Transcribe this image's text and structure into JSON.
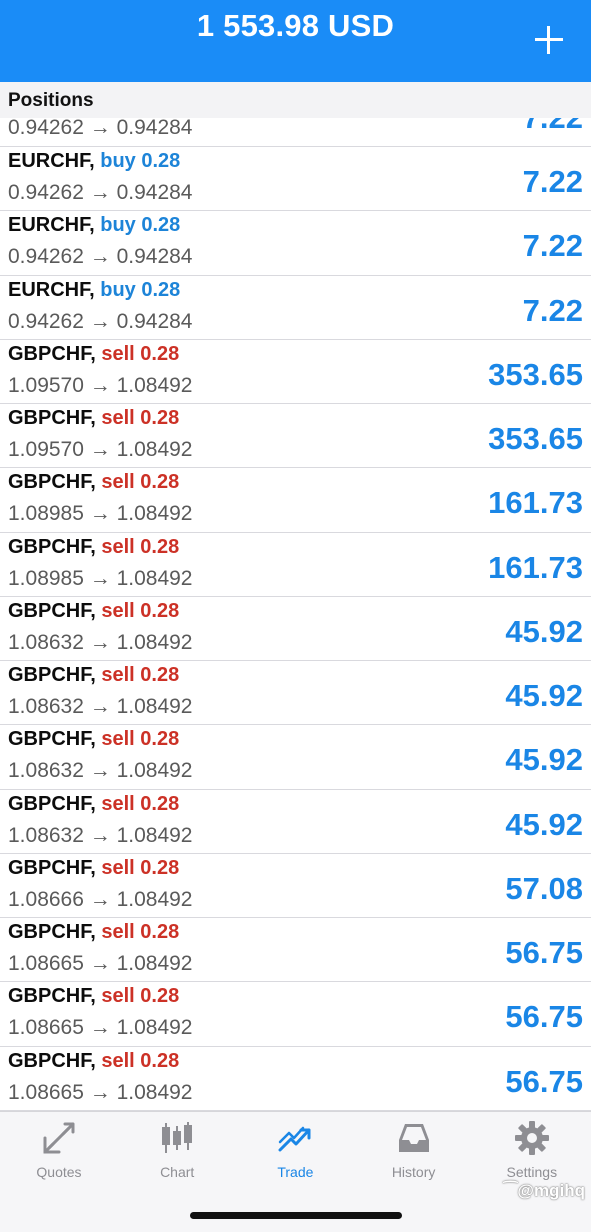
{
  "header": {
    "title": "1 553.98 USD",
    "add_icon": "plus-icon"
  },
  "section": {
    "title": "Positions"
  },
  "partial_row": {
    "prices": "0.94262 → 0.94284",
    "profit": "7.22"
  },
  "positions": [
    {
      "symbol": "EURCHF,",
      "side": "buy 0.28",
      "type": "buy",
      "prices": "0.94262 → 0.94284",
      "profit": "7.22"
    },
    {
      "symbol": "EURCHF,",
      "side": "buy 0.28",
      "type": "buy",
      "prices": "0.94262 → 0.94284",
      "profit": "7.22"
    },
    {
      "symbol": "EURCHF,",
      "side": "buy 0.28",
      "type": "buy",
      "prices": "0.94262 → 0.94284",
      "profit": "7.22"
    },
    {
      "symbol": "GBPCHF,",
      "side": "sell 0.28",
      "type": "sell",
      "prices": "1.09570 → 1.08492",
      "profit": "353.65"
    },
    {
      "symbol": "GBPCHF,",
      "side": "sell 0.28",
      "type": "sell",
      "prices": "1.09570 → 1.08492",
      "profit": "353.65"
    },
    {
      "symbol": "GBPCHF,",
      "side": "sell 0.28",
      "type": "sell",
      "prices": "1.08985 → 1.08492",
      "profit": "161.73"
    },
    {
      "symbol": "GBPCHF,",
      "side": "sell 0.28",
      "type": "sell",
      "prices": "1.08985 → 1.08492",
      "profit": "161.73"
    },
    {
      "symbol": "GBPCHF,",
      "side": "sell 0.28",
      "type": "sell",
      "prices": "1.08632 → 1.08492",
      "profit": "45.92"
    },
    {
      "symbol": "GBPCHF,",
      "side": "sell 0.28",
      "type": "sell",
      "prices": "1.08632 → 1.08492",
      "profit": "45.92"
    },
    {
      "symbol": "GBPCHF,",
      "side": "sell 0.28",
      "type": "sell",
      "prices": "1.08632 → 1.08492",
      "profit": "45.92"
    },
    {
      "symbol": "GBPCHF,",
      "side": "sell 0.28",
      "type": "sell",
      "prices": "1.08632 → 1.08492",
      "profit": "45.92"
    },
    {
      "symbol": "GBPCHF,",
      "side": "sell 0.28",
      "type": "sell",
      "prices": "1.08666 → 1.08492",
      "profit": "57.08"
    },
    {
      "symbol": "GBPCHF,",
      "side": "sell 0.28",
      "type": "sell",
      "prices": "1.08665 → 1.08492",
      "profit": "56.75"
    },
    {
      "symbol": "GBPCHF,",
      "side": "sell 0.28",
      "type": "sell",
      "prices": "1.08665 → 1.08492",
      "profit": "56.75"
    },
    {
      "symbol": "GBPCHF,",
      "side": "sell 0.28",
      "type": "sell",
      "prices": "1.08665 → 1.08492",
      "profit": "56.75"
    }
  ],
  "tabs": [
    {
      "label": "Quotes",
      "icon": "quotes-icon",
      "active": false
    },
    {
      "label": "Chart",
      "icon": "candlestick-chart-icon",
      "active": false
    },
    {
      "label": "Trade",
      "icon": "trade-icon",
      "active": true
    },
    {
      "label": "History",
      "icon": "inbox-tray-icon",
      "active": false
    },
    {
      "label": "Settings",
      "icon": "gear-icon",
      "active": false
    }
  ],
  "colors": {
    "header_bg": "#1a8cf7",
    "buy": "#1d84d8",
    "sell": "#cc3126",
    "profit": "#1a86e6",
    "tab_inactive": "#8e8e93",
    "tab_active": "#1a86e6"
  },
  "watermark": "⁀@mgihq"
}
